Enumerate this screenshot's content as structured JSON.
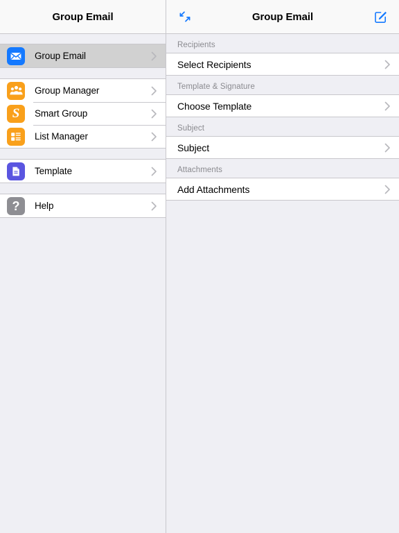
{
  "sidebar": {
    "navbar": {
      "title": "Group Email"
    },
    "groups": [
      {
        "items": [
          {
            "label": "Group Email",
            "icon": "envelope-icon",
            "icon_color": "#1479ff",
            "selected": true
          }
        ]
      },
      {
        "items": [
          {
            "label": "Group Manager",
            "icon": "people-group-icon",
            "icon_color": "#f9a01b",
            "selected": false
          },
          {
            "label": "Smart Group",
            "icon": "smart-group-s-icon",
            "icon_color": "#f9a01b",
            "selected": false
          },
          {
            "label": "List Manager",
            "icon": "list-icon",
            "icon_color": "#f9a01b",
            "selected": false
          }
        ]
      },
      {
        "items": [
          {
            "label": "Template",
            "icon": "document-icon",
            "icon_color": "#5a55e0",
            "selected": false
          }
        ]
      },
      {
        "items": [
          {
            "label": "Help",
            "icon": "question-mark-icon",
            "icon_color": "#8e8e93",
            "selected": false
          }
        ]
      }
    ]
  },
  "detail": {
    "navbar": {
      "title": "Group Email",
      "collapse_icon": "collapse-arrows-icon",
      "compose_icon": "compose-icon",
      "tint_color": "#1479ff"
    },
    "sections": [
      {
        "header": "Recipients",
        "cell_label": "Select Recipients"
      },
      {
        "header": "Template & Signature",
        "cell_label": "Choose Template"
      },
      {
        "header": "Subject",
        "cell_label": "Subject"
      },
      {
        "header": "Attachments",
        "cell_label": "Add Attachments"
      }
    ]
  }
}
